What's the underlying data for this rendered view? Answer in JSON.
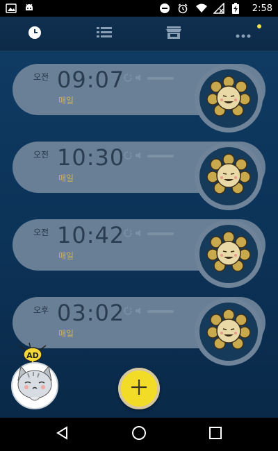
{
  "status_bar": {
    "time": "2:58",
    "left_icons": [
      "image-icon",
      "android-icon"
    ],
    "right_icons": [
      "dnd-icon",
      "alarm-clock-icon",
      "wifi-icon",
      "no-signal-icon",
      "battery-charging-icon"
    ]
  },
  "tabs": [
    {
      "icon": "clock-icon",
      "active": true
    },
    {
      "icon": "list-icon",
      "active": false
    },
    {
      "icon": "store-icon",
      "active": false
    },
    {
      "icon": "more-icon",
      "active": false,
      "badge": true
    }
  ],
  "alarms": [
    {
      "ampm": "오전",
      "time": "09:07",
      "repeat": "매일"
    },
    {
      "ampm": "오전",
      "time": "10:30",
      "repeat": "매일"
    },
    {
      "ampm": "오전",
      "time": "10:42",
      "repeat": "매일"
    },
    {
      "ampm": "오후",
      "time": "03:02",
      "repeat": "매일"
    }
  ],
  "ad": {
    "badge": "AD"
  },
  "colors": {
    "accent": "#f2dc28",
    "badge": "#f3e34a",
    "repeat_text": "#c9b45a"
  }
}
